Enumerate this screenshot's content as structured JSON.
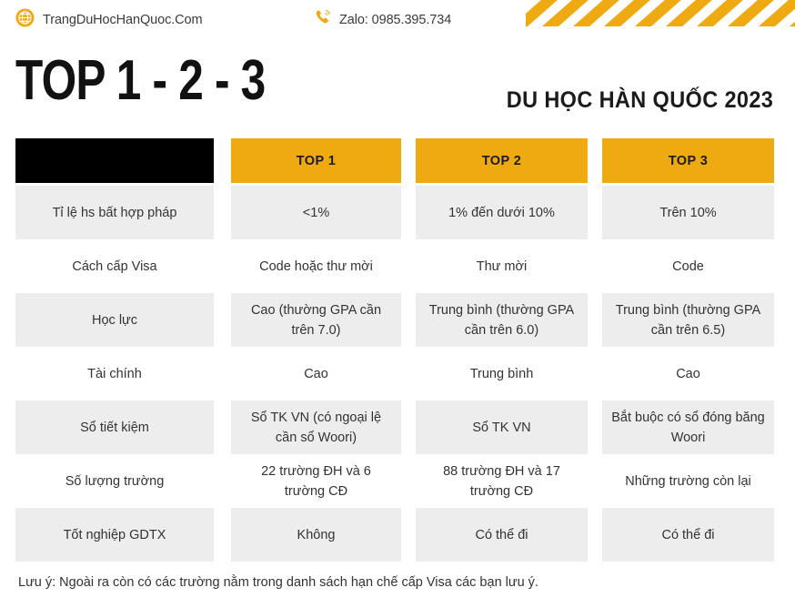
{
  "topbar": {
    "site_icon": "globe-icon",
    "site_name": "TrangDuHocHanQuoc.Com",
    "contact_icon": "phone-ringing-icon",
    "contact_text": "Zalo: 0985.395.734",
    "stripe_decoration": "diagonal-stripes"
  },
  "heading": {
    "title": "TOP 1 - 2 - 3",
    "subtitle": "DU HỌC HÀN QUỐC 2023"
  },
  "colors": {
    "gold": "#EFA911",
    "black": "#000000",
    "row_shade": "#ededed",
    "text": "#333333"
  },
  "table": {
    "headers": [
      "",
      "TOP 1",
      "TOP 2",
      "TOP 3"
    ],
    "rows": [
      {
        "shaded": true,
        "cells": [
          "Tỉ lệ hs bất hợp pháp",
          "<1%",
          "1% đến dưới 10%",
          "Trên 10%"
        ]
      },
      {
        "shaded": false,
        "cells": [
          "Cách cấp Visa",
          "Code hoặc thư mời",
          "Thư mời",
          "Code"
        ]
      },
      {
        "shaded": true,
        "cells": [
          "Học lực",
          "Cao (thường GPA cần trên 7.0)",
          "Trung bình (thường GPA cần trên 6.0)",
          "Trung bình (thường GPA cần trên 6.5)"
        ]
      },
      {
        "shaded": false,
        "cells": [
          "Tài chính",
          "Cao",
          "Trung bình",
          "Cao"
        ]
      },
      {
        "shaded": true,
        "cells": [
          "Sổ tiết kiệm",
          "Sổ TK VN (có ngoại lệ cần sổ Woori)",
          "Sổ TK VN",
          "Bắt buộc có sổ đóng băng Woori"
        ]
      },
      {
        "shaded": false,
        "cells": [
          "Số lượng trường",
          "22 trường ĐH và 6 trường CĐ",
          "88 trường ĐH và 17 trường CĐ",
          "Những trường còn lại"
        ]
      },
      {
        "shaded": true,
        "cells": [
          "Tốt nghiệp GDTX",
          "Không",
          "Có thể đi",
          "Có thể đi"
        ]
      }
    ]
  },
  "footer": {
    "note": "Lưu ý: Ngoài ra còn có các trường nằm trong danh sách hạn chế cấp Visa các bạn lưu ý."
  }
}
